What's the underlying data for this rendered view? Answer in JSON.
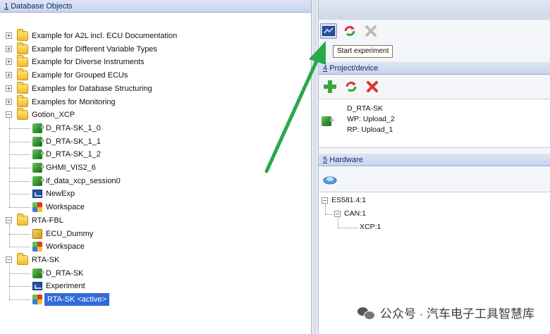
{
  "left_pane": {
    "header_num": "1",
    "header_title": "Database Objects",
    "items": [
      {
        "label": "Example for A2L incl. ECU Documentation",
        "icon": "folder-icon"
      },
      {
        "label": "Example for Different Variable Types",
        "icon": "folder-icon"
      },
      {
        "label": "Example for Diverse Instruments",
        "icon": "folder-icon"
      },
      {
        "label": "Example for Grouped ECUs",
        "icon": "folder-icon"
      },
      {
        "label": "Examples for Database Structuring",
        "icon": "folder-icon"
      },
      {
        "label": "Examples for Monitoring",
        "icon": "folder-icon"
      },
      {
        "label": "Gotion_XCP",
        "icon": "folder-icon"
      },
      {
        "label": "D_RTA-SK_1_0",
        "icon": "device-icon"
      },
      {
        "label": "D_RTA-SK_1_1",
        "icon": "device-icon"
      },
      {
        "label": "D_RTA-SK_1_2",
        "icon": "device-icon"
      },
      {
        "label": "GHMI_VIS2_6",
        "icon": "device-icon"
      },
      {
        "label": "if_data_xcp_session0",
        "icon": "device-icon"
      },
      {
        "label": "NewExp",
        "icon": "experiment-icon"
      },
      {
        "label": "Workspace",
        "icon": "workspace-icon"
      },
      {
        "label": "RTA-FBL",
        "icon": "folder-icon"
      },
      {
        "label": "ECU_Dummy",
        "icon": "ecu-icon"
      },
      {
        "label": "Workspace",
        "icon": "workspace-icon"
      },
      {
        "label": "RTA-SK",
        "icon": "folder-icon"
      },
      {
        "label": "D_RTA-SK",
        "icon": "device-icon"
      },
      {
        "label": "Experiment",
        "icon": "experiment-icon"
      },
      {
        "label": "RTA-SK <active>",
        "icon": "workspace-icon"
      }
    ]
  },
  "toolbar_top": {
    "tooltip": "Start experiment",
    "buttons": [
      "start-experiment-icon",
      "refresh-icon",
      "delete-icon"
    ]
  },
  "project_device": {
    "header_num": "4",
    "header_title": "Project/device",
    "buttons": [
      "add-icon",
      "refresh-icon",
      "delete-icon"
    ],
    "device_name": "D_RTA-SK",
    "wp": "WP: Upload_2",
    "rp": "RP: Upload_1"
  },
  "hardware": {
    "header_num": "5",
    "header_title": "Hardware",
    "nodes": [
      "ES581.4:1",
      "CAN:1",
      "XCP:1"
    ]
  },
  "watermark": "公众号 · 汽车电子工具智慧库",
  "colors": {
    "arrow": "#2aa84a",
    "selection": "#2f6ad8",
    "header": "#c7d4ec"
  }
}
